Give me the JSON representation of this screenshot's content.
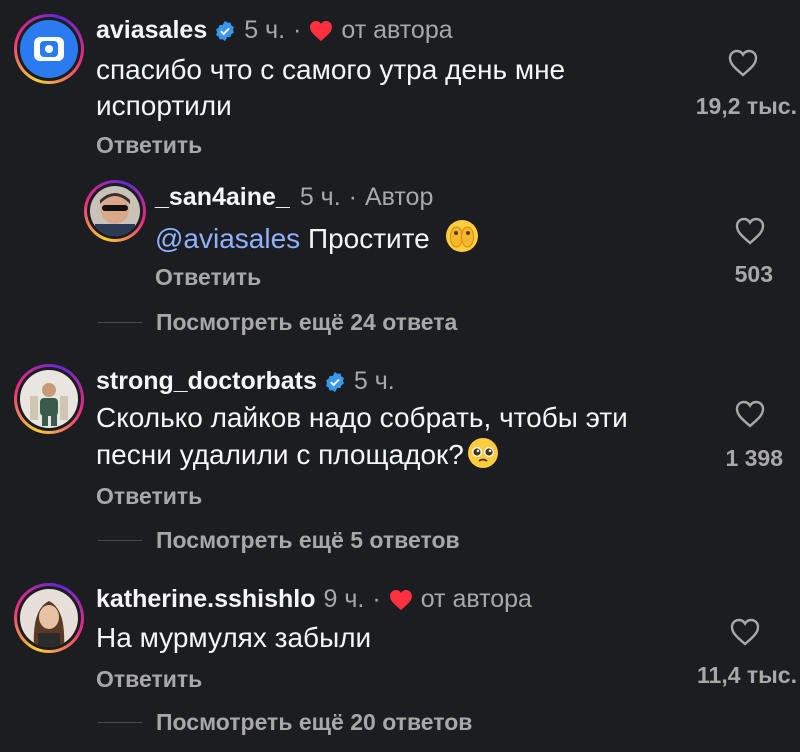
{
  "comments": [
    {
      "username": "aviasales",
      "time": "5 ч.",
      "separator": "·",
      "author_liked_label": "от автора",
      "text": "спасибо что с самого утра день мне испортили",
      "reply_label": "Ответить",
      "likes": "19,2 тыс."
    },
    {
      "username": "_san4aine_",
      "time": "5 ч.",
      "separator": "·",
      "author_label": "Автор",
      "mention": "@aviasales",
      "text": "Простите",
      "reply_label": "Ответить",
      "likes": "503",
      "more_replies": "Посмотреть ещё 24 ответа"
    },
    {
      "username": "strong_doctorbats",
      "time": "5 ч.",
      "text": "Сколько лайков надо собрать, чтобы эти песни удалили с площадок?",
      "reply_label": "Ответить",
      "likes": "1 398",
      "more_replies": "Посмотреть ещё 5 ответов"
    },
    {
      "username": "katherine.sshishlo",
      "time": "9 ч.",
      "separator": "·",
      "author_liked_label": "от автора",
      "text": "На мурмулях забыли",
      "reply_label": "Ответить",
      "likes": "11,4 тыс.",
      "more_replies": "Посмотреть ещё 20 ответов"
    }
  ],
  "colors": {
    "background": "#1c1d21",
    "text": "#f5f5f5",
    "secondary": "#a8a8a8",
    "mention": "#8fb1ff",
    "verified": "#3897f0",
    "heart_red": "#ff3040"
  },
  "icons": [
    "verified-badge-icon",
    "author-heart-icon",
    "like-heart-icon",
    "emoji-face-icon"
  ]
}
